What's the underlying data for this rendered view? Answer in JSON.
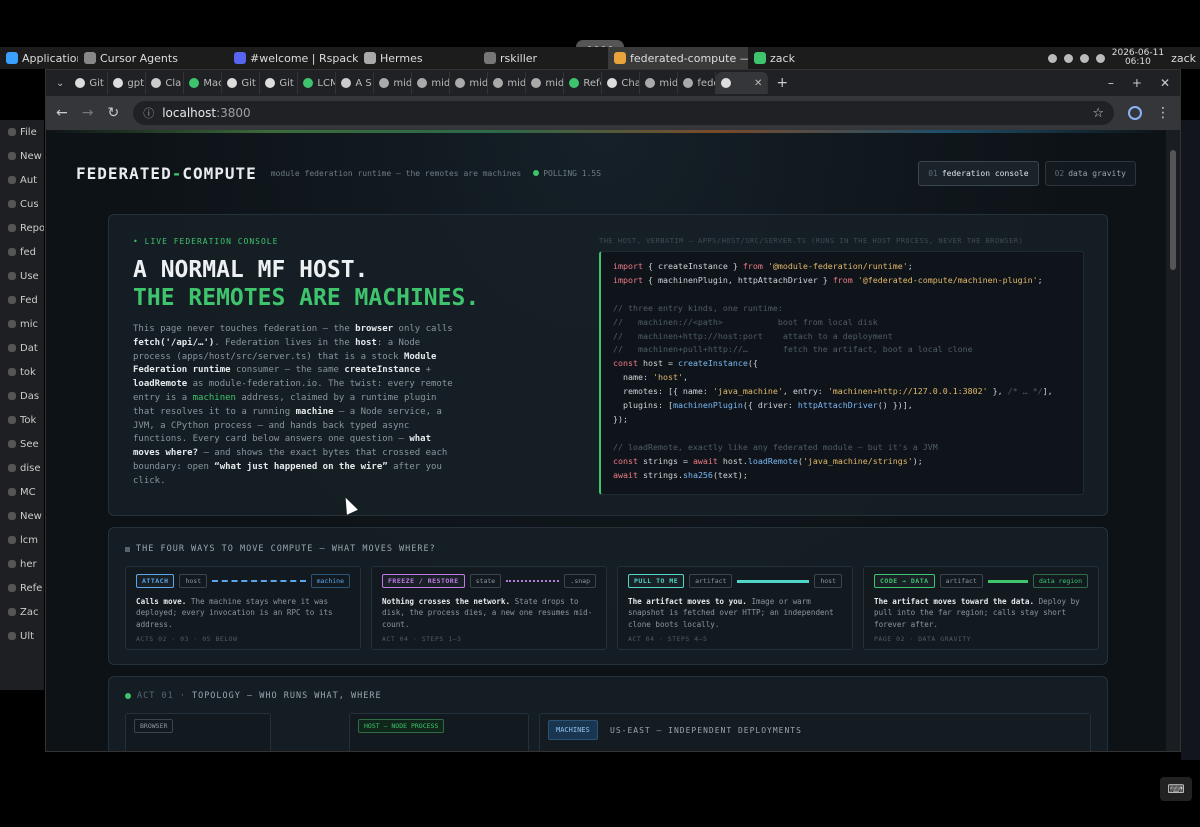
{
  "taskbar": {
    "items": [
      {
        "label": "Applications",
        "icon": "x-logo-icon",
        "color": "#3aa0ff"
      },
      {
        "label": "Cursor Agents",
        "icon": "cursor-icon",
        "color": "#888888"
      },
      {
        "label": "#welcome | Rspack - ...",
        "icon": "discord-icon",
        "color": "#5865f2"
      },
      {
        "label": "Hermes",
        "icon": "hermes-icon",
        "color": "#aaaaaa"
      },
      {
        "label": "rskiller",
        "icon": "terminal-icon",
        "color": "#777777"
      },
      {
        "label": "federated-compute — ...",
        "icon": "chrome-icon",
        "color": "#e8a33d"
      },
      {
        "label": "zack",
        "icon": "terminal-icon",
        "color": "#3ec46d"
      }
    ],
    "date": "2026-06-11",
    "time": "06:10",
    "user": "zack"
  },
  "left_app": {
    "items": [
      "File",
      "New",
      "Aut",
      "Cus",
      "Reposit",
      "fed",
      "Use",
      "Fed",
      "mic",
      "Dat",
      "tok",
      "Das",
      "Tok",
      "See",
      "dise",
      "MC",
      "New",
      "lcm",
      "her",
      "Refe",
      "Zac",
      "Ult"
    ]
  },
  "browser": {
    "tabs": [
      "Git",
      "gpt",
      "Cla",
      "Mac",
      "Git",
      "Git",
      "LCM",
      "A S",
      "mid",
      "mid",
      "mid",
      "mid",
      "mid",
      "Refe",
      "Cha",
      "mid",
      "fede",
      ""
    ],
    "url_host": "localhost",
    "url_port": ":3800"
  },
  "page": {
    "brand_a": "FEDERATED",
    "brand_dash": "-",
    "brand_b": "COMPUTE",
    "tagline": "module federation runtime — the remotes are machines",
    "polling": "POLLING 1.5S",
    "nav": [
      {
        "num": "01",
        "label": "federation console"
      },
      {
        "num": "02",
        "label": "data gravity"
      }
    ]
  },
  "hero": {
    "eyebrow": "• LIVE FEDERATION CONSOLE",
    "title_1": "A NORMAL MF HOST.",
    "title_2": "THE REMOTES ARE MACHINES.",
    "body": [
      {
        "t": "This page never touches federation — the "
      },
      {
        "b": "browser"
      },
      {
        "t": " only calls "
      },
      {
        "b": "fetch('/api/…')"
      },
      {
        "t": ". Federation lives in the "
      },
      {
        "b": "host"
      },
      {
        "t": ": a Node process (apps/host/src/server.ts) that is a stock "
      },
      {
        "b": "Module Federation runtime"
      },
      {
        "t": " consumer — the same "
      },
      {
        "b": "createInstance"
      },
      {
        "t": " + "
      },
      {
        "b": "loadRemote"
      },
      {
        "t": " as module-federation.io. The twist: every remote entry is a "
      },
      {
        "g": "machinen"
      },
      {
        "t": " address, claimed by a runtime plugin that resolves it to a running "
      },
      {
        "b": "machine"
      },
      {
        "t": " — a Node service, a JVM, a CPython process — and hands back typed async functions. Every card below answers one question — "
      },
      {
        "b": "what moves where?"
      },
      {
        "t": " — and shows the exact bytes that crossed each boundary: open "
      },
      {
        "b": "“what just happened on the wire”"
      },
      {
        "t": " after you click."
      }
    ],
    "code_label": "THE HOST, VERBATIM — APPS/HOST/SRC/SERVER.TS (RUNS IN THE HOST PROCESS, NEVER THE BROWSER)",
    "code": [
      [
        [
          "k",
          "import"
        ],
        [
          "p",
          " { createInstance } "
        ],
        [
          "k",
          "from"
        ],
        [
          "s",
          " '@module-federation/runtime'"
        ],
        [
          "p",
          ";"
        ]
      ],
      [
        [
          "k",
          "import"
        ],
        [
          "p",
          " { machinenPlugin, httpAttachDriver } "
        ],
        [
          "k",
          "from"
        ],
        [
          "s",
          " '@federated-compute/machinen-plugin'"
        ],
        [
          "p",
          ";"
        ]
      ],
      [
        [
          "p",
          ""
        ]
      ],
      [
        [
          "c",
          "// three entry kinds, one runtime:"
        ]
      ],
      [
        [
          "c",
          "//   machinen://<path>           boot from local disk"
        ]
      ],
      [
        [
          "c",
          "//   machinen+http://host:port    attach to a deployment"
        ]
      ],
      [
        [
          "c",
          "//   machinen+pull+http://…       fetch the artifact, boot a local clone"
        ]
      ],
      [
        [
          "k",
          "const"
        ],
        [
          "p",
          " host = "
        ],
        [
          "f",
          "createInstance"
        ],
        [
          "p",
          "({"
        ]
      ],
      [
        [
          "p",
          "  name: "
        ],
        [
          "s",
          "'host'"
        ],
        [
          "p",
          ","
        ]
      ],
      [
        [
          "p",
          "  remotes: [{ name: "
        ],
        [
          "s",
          "'java_machine'"
        ],
        [
          "p",
          ", entry: "
        ],
        [
          "s",
          "'machinen+http://127.0.0.1:3802'"
        ],
        [
          "p",
          " }, "
        ],
        [
          "c",
          "/* … */"
        ],
        [
          "p",
          "],"
        ]
      ],
      [
        [
          "p",
          "  plugins: ["
        ],
        [
          "f",
          "machinenPlugin"
        ],
        [
          "p",
          "({ driver: "
        ],
        [
          "f",
          "httpAttachDriver"
        ],
        [
          "p",
          "() })],"
        ]
      ],
      [
        [
          "p",
          "});"
        ]
      ],
      [
        [
          "p",
          ""
        ]
      ],
      [
        [
          "c",
          "// loadRemote, exactly like any federated module — but it's a JVM"
        ]
      ],
      [
        [
          "k",
          "const"
        ],
        [
          "p",
          " strings = "
        ],
        [
          "k",
          "await"
        ],
        [
          "p",
          " host."
        ],
        [
          "f",
          "loadRemote"
        ],
        [
          "p",
          "("
        ],
        [
          "s",
          "'java_machine/strings'"
        ],
        [
          "p",
          ");"
        ]
      ],
      [
        [
          "k",
          "await"
        ],
        [
          "p",
          " strings."
        ],
        [
          "f",
          "sha256"
        ],
        [
          "p",
          "(text);"
        ]
      ]
    ]
  },
  "four_ways": {
    "title": "THE FOUR WAYS TO MOVE COMPUTE — WHAT MOVES WHERE?",
    "cards": [
      {
        "tag": "ATTACH",
        "tag_color": "#5aa7ee",
        "from": "host",
        "to": "machine",
        "arrow": "dashed",
        "arrow_color": "#5aa7ee",
        "lead": "Calls move.",
        "desc": " The machine stays where it was deployed; every invocation is an RPC to its address.",
        "foot": "ACTS 02 · 03 · 05 BELOW"
      },
      {
        "tag": "FREEZE / RESTORE",
        "tag_color": "#c07ae8",
        "from": "state",
        "to": ".snap",
        "arrow": "dotted",
        "arrow_color": "#b27adb",
        "lead": "Nothing crosses the network.",
        "desc": " State drops to disk, the process dies, a new one resumes mid-count.",
        "foot": "ACT 04 · STEPS 1–3"
      },
      {
        "tag": "PULL TO ME",
        "tag_color": "#4fd6c8",
        "from": "artifact",
        "to": "host",
        "arrow": "solid",
        "arrow_color": "#4fd6c8",
        "lead": "The artifact moves to you.",
        "desc": " Image or warm snapshot is fetched over HTTP; an independent clone boots locally.",
        "foot": "ACT 04 · STEPS 4–5"
      },
      {
        "tag": "CODE → DATA",
        "tag_color": "#3ec46d",
        "from": "artifact",
        "to": "data region",
        "arrow": "solid",
        "arrow_color": "#3ec46d",
        "lead": "The artifact moves toward the data.",
        "desc": " Deploy by pull into the far region; calls stay short forever after.",
        "foot": "PAGE 02 · DATA GRAVITY"
      }
    ]
  },
  "topology": {
    "act": "ACT 01 ·",
    "title": "TOPOLOGY — WHO RUNS WHAT, WHERE",
    "browser_label": "BROWSER",
    "host_label": "HOST — NODE PROCESS",
    "machines_label": "MACHINES",
    "region_label": "US-EAST — INDEPENDENT DEPLOYMENTS"
  },
  "colors": {
    "accent": "#3ec46d",
    "bg": "#0d1216",
    "card": "#162026"
  }
}
